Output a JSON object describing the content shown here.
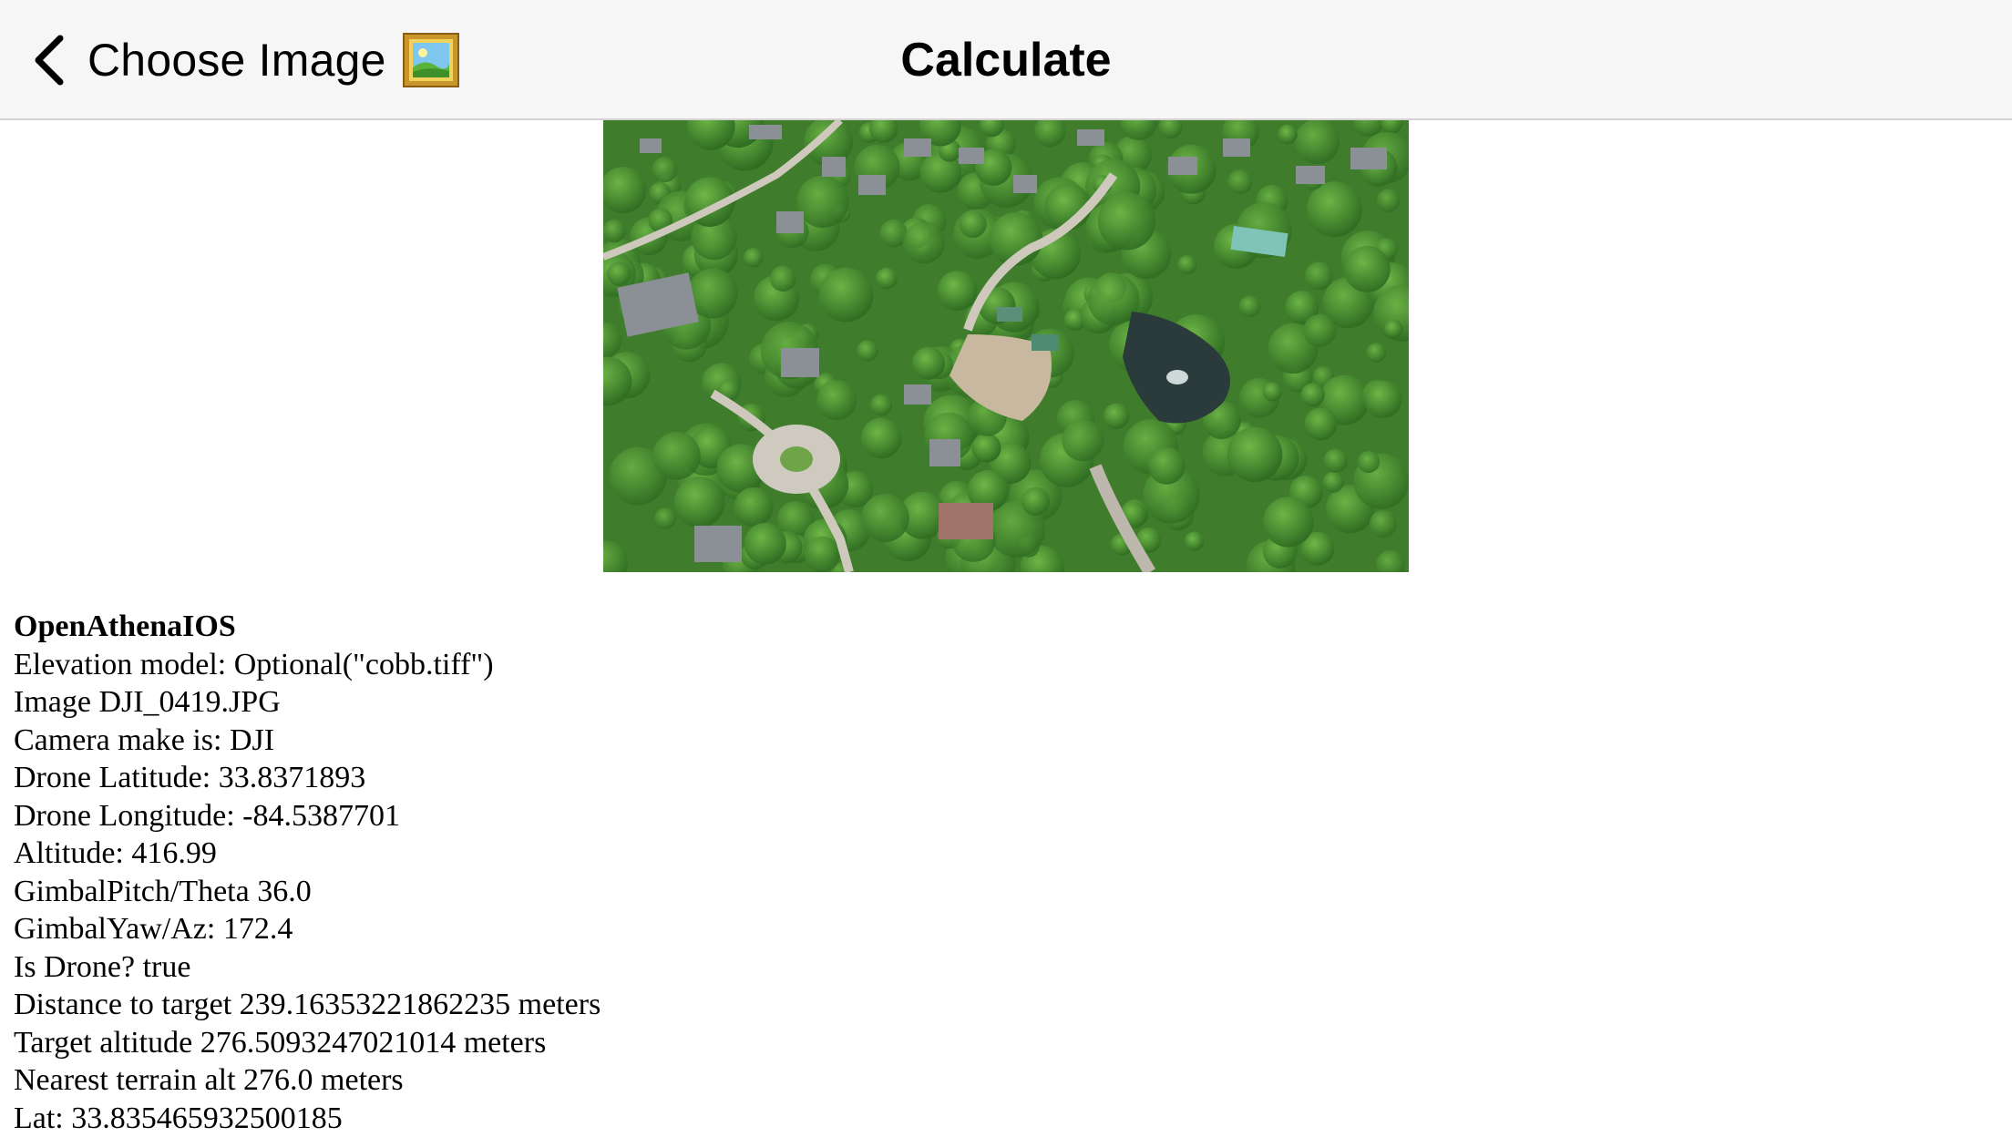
{
  "nav": {
    "back_label": "Choose Image",
    "back_icon": "chevron-left-icon",
    "picture_icon": "framed-picture-icon",
    "title": "Calculate"
  },
  "photo": {
    "icon": "aerial-photo"
  },
  "output": {
    "heading": "OpenAthenaIOS",
    "lines": [
      "Elevation model: Optional(\"cobb.tiff\")",
      "Image DJI_0419.JPG",
      "Camera make is: DJI",
      "Drone Latitude: 33.8371893",
      "Drone Longitude: -84.5387701",
      "Altitude: 416.99",
      "GimbalPitch/Theta 36.0",
      "GimbalYaw/Az: 172.4",
      "Is Drone? true",
      "Distance to target 239.16353221862235 meters",
      "Target altitude 276.5093247021014 meters",
      "Nearest terrain alt 276.0 meters",
      "Lat: 33.835465932500185"
    ]
  },
  "colors": {
    "navbar_bg": "#f6f6f6",
    "text": "#000000"
  }
}
